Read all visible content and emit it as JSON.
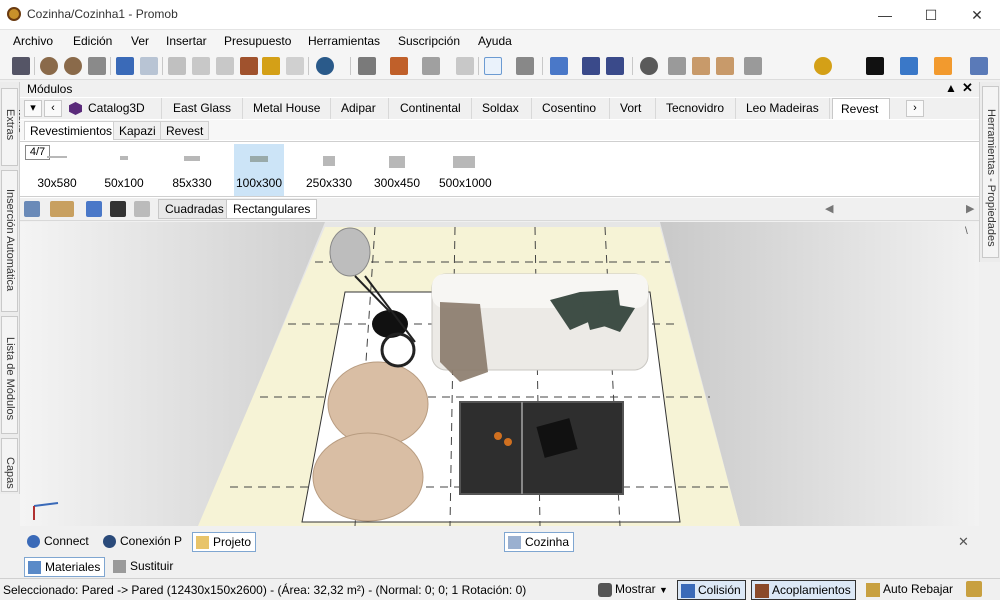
{
  "window": {
    "title": "Cozinha/Cozinha1 - Promob",
    "minimize_icon": "minimize-icon",
    "maximize_icon": "maximize-icon",
    "close_icon": "close-icon"
  },
  "menu": [
    "Archivo",
    "Edición",
    "Ver",
    "Insertar",
    "Presupuesto",
    "Herramientas",
    "Suscripción",
    "Ayuda"
  ],
  "left_strip": {
    "tabs": [
      "Itens Extras",
      "Inserción Automática",
      "Lista de Módulos",
      "Capas"
    ]
  },
  "right_strip": {
    "tabs": [
      "Herramientas - Propiedades"
    ]
  },
  "modulos": {
    "title": "Módulos",
    "catalog_tabs": [
      "Catalog3D",
      "East Glass",
      "Metal House",
      "Adipar",
      "Continental",
      "Soldax",
      "Cosentino",
      "Vort",
      "Tecnovidro",
      "Leo Madeiras",
      "Revest"
    ],
    "active_catalog": "Revest",
    "sub_tabs": [
      "Revestimientos",
      "Kapazi",
      "Revest"
    ],
    "page_counter": "4/7",
    "items": [
      "30x580",
      "50x100",
      "85x330",
      "100x300",
      "250x330",
      "300x450",
      "500x1000"
    ],
    "selected_item": "100x300"
  },
  "view_toolbar": {
    "tabs": [
      "Cuadradas",
      "Rectangulares"
    ],
    "active_tab": "Rectangulares"
  },
  "bottom_tabs": [
    "Connect",
    "Conexión P",
    "Projeto"
  ],
  "active_bottom_tab": "Projeto",
  "document_tab": "Cozinha",
  "lower_tabs": [
    "Materiales",
    "Sustituir"
  ],
  "status": {
    "selection": "Seleccionado: Pared -> Pared (12430x150x2600) - (Área: 32,32 m²) - (Normal: 0; 0; 1 Rotación: 0)",
    "mostrar": "Mostrar",
    "colision": "Colisión",
    "acoplamientos": "Acoplamientos",
    "auto_rebajar": "Auto Rebajar"
  },
  "colors": {
    "accent": "#2a6fc9",
    "selection_bg": "#cce4f7",
    "floor": "#f6f3d6",
    "sofa": "#eceae6",
    "chair": "#d9bea4",
    "table": "#2e2e2e"
  }
}
